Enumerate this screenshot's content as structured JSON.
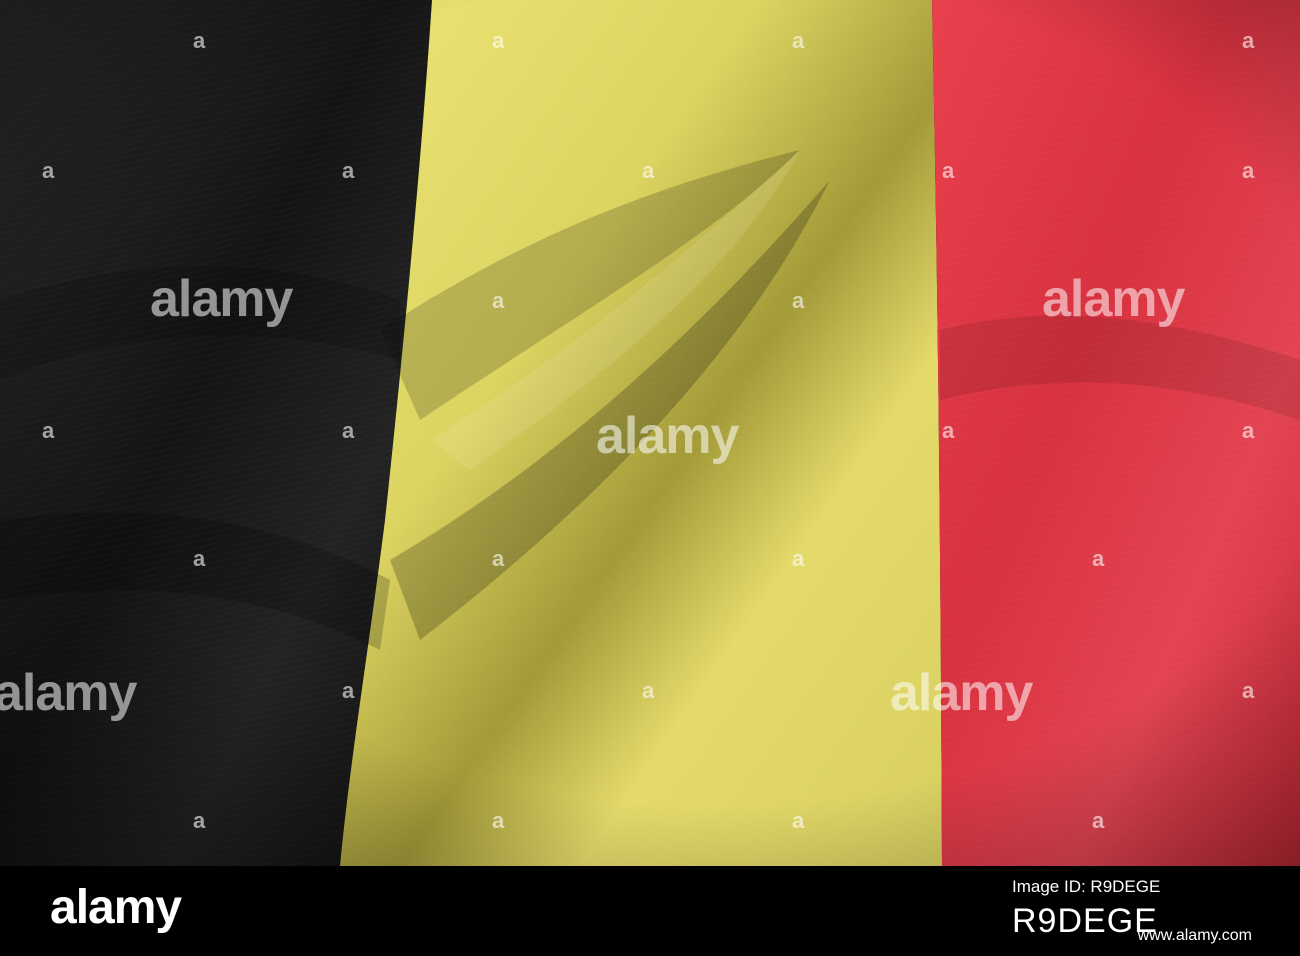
{
  "flag": {
    "colors": {
      "black_band": "#141414",
      "yellow_band": "#e6dc6a",
      "red_band": "#e03a48"
    }
  },
  "watermark": {
    "text": "alamy",
    "glyph": "a",
    "color": "#ffffff"
  },
  "footer": {
    "logo": "alamy",
    "image_id_label": "Image ID: R9DEGE",
    "image_id": "R9DEGE",
    "url": "www.alamy.com"
  }
}
